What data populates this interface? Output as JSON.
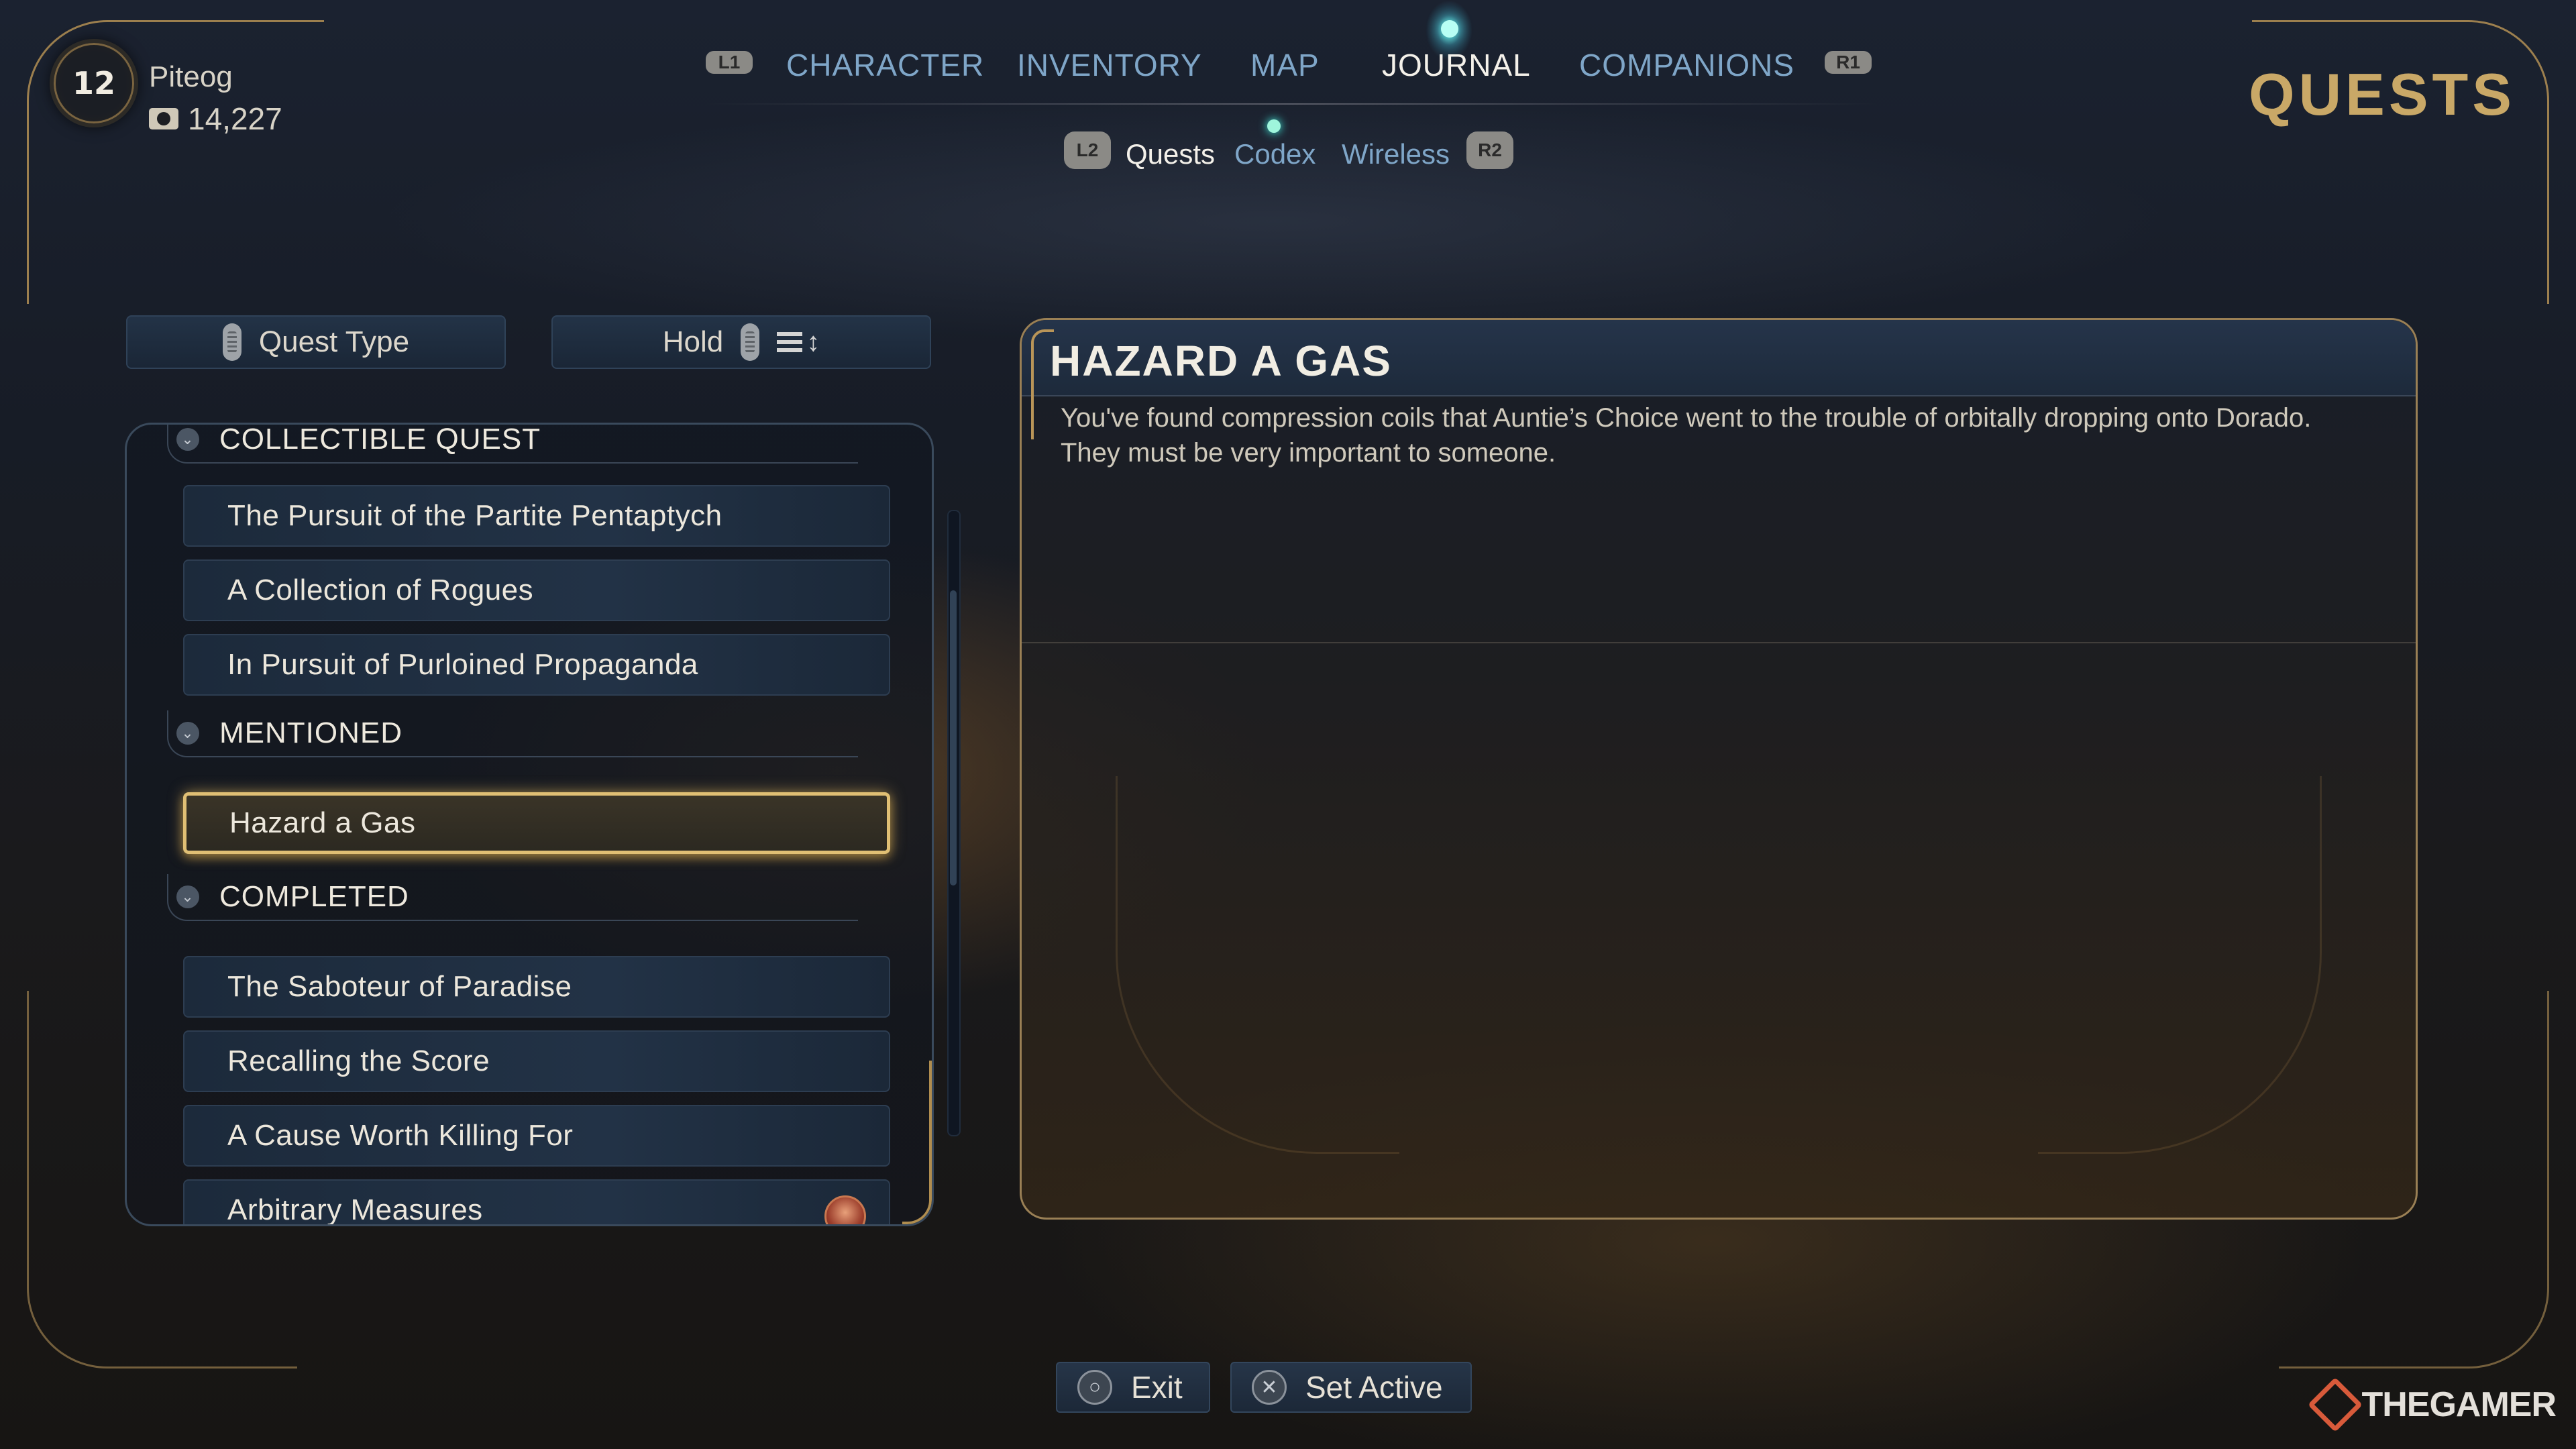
{
  "player": {
    "level": "12",
    "name": "Piteog",
    "credits": "14,227"
  },
  "nav": {
    "left_shoulder": "L1",
    "right_shoulder": "R1",
    "tabs": [
      {
        "label": "CHARACTER"
      },
      {
        "label": "INVENTORY"
      },
      {
        "label": "MAP"
      },
      {
        "label": "JOURNAL",
        "active": true
      },
      {
        "label": "COMPANIONS"
      }
    ]
  },
  "subnav": {
    "left_shoulder": "L2",
    "right_shoulder": "R2",
    "tabs": [
      {
        "label": "Quests",
        "active": true
      },
      {
        "label": "Codex",
        "notification": true
      },
      {
        "label": "Wireless"
      }
    ]
  },
  "page_title": "QUESTS",
  "filters": {
    "quest_type_label": "Quest Type",
    "sort_label": "Hold"
  },
  "quest_list": {
    "groups": [
      {
        "header": "COLLECTIBLE QUEST",
        "items": [
          "The Pursuit of the Partite Pentaptych",
          "A Collection of Rogues",
          "In Pursuit of Purloined Propaganda"
        ]
      },
      {
        "header": "MENTIONED",
        "items": [
          "Hazard a Gas"
        ]
      },
      {
        "header": "COMPLETED",
        "items": [
          "The Saboteur of Paradise",
          "Recalling the Score",
          "A Cause Worth Killing For",
          "Arbitrary Measures"
        ]
      }
    ],
    "selected": "Hazard a Gas"
  },
  "detail": {
    "title": "HAZARD A GAS",
    "description": "You've found compression coils that Auntie’s Choice went to the trouble of orbitally dropping onto Dorado. They must be very important to someone."
  },
  "actions": {
    "exit_label": "Exit",
    "set_active_label": "Set Active"
  },
  "watermark": "THEGAMER",
  "colors": {
    "accent_gold": "#c9a867",
    "tab_blue": "#7fa6c8",
    "selected_border": "#e0bf74"
  }
}
